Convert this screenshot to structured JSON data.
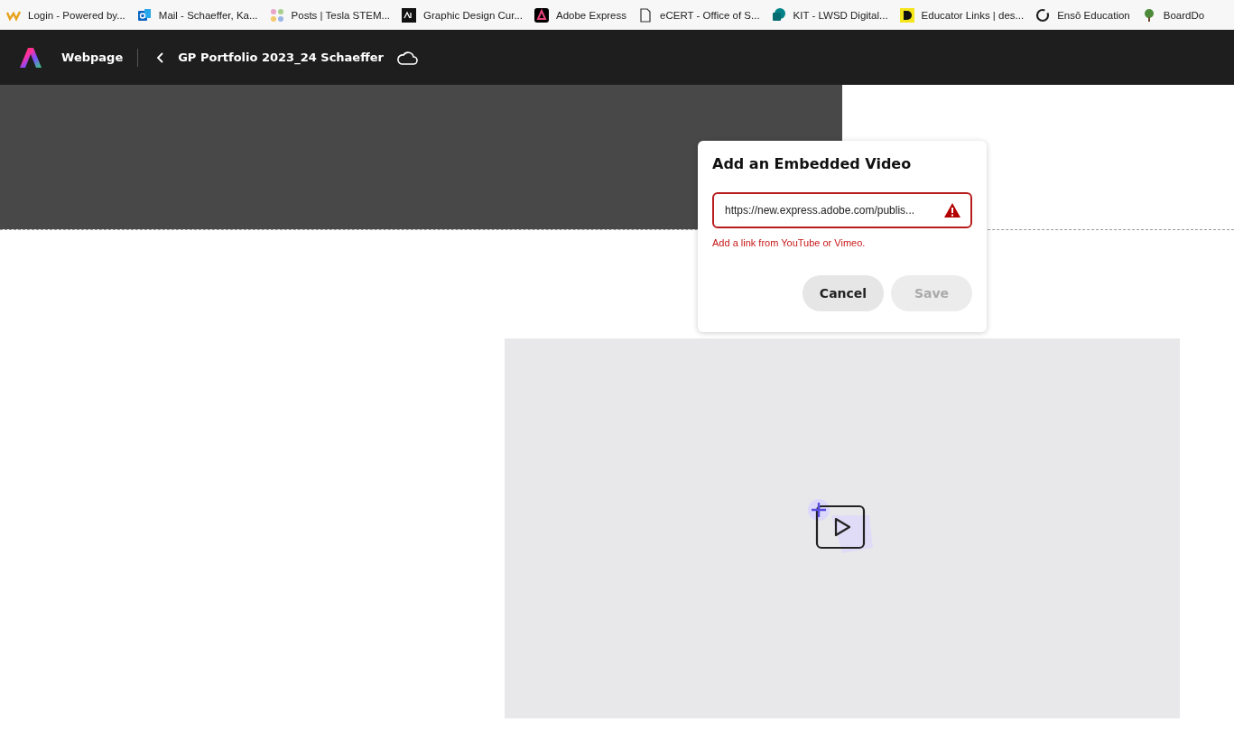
{
  "bookmarks": [
    {
      "label": "Login - Powered by..."
    },
    {
      "label": "Mail - Schaeffer, Ka..."
    },
    {
      "label": "Posts | Tesla STEM..."
    },
    {
      "label": "Graphic Design Cur..."
    },
    {
      "label": "Adobe Express"
    },
    {
      "label": "eCERT - Office of S..."
    },
    {
      "label": "KIT - LWSD Digital..."
    },
    {
      "label": "Educator Links | des..."
    },
    {
      "label": "Ensō Education"
    },
    {
      "label": "BoardDo"
    }
  ],
  "app_bar": {
    "mode": "Webpage",
    "project_title": "GP Portfolio 2023_24 Schaeffer"
  },
  "dialog": {
    "title": "Add an Embedded Video",
    "field": {
      "value": "https://new.express.adobe.com/publis...",
      "error": true
    },
    "error_message": "Add a link from YouTube or Vimeo.",
    "buttons": [
      {
        "label": "Cancel",
        "disabled": false
      },
      {
        "label": "Save",
        "disabled": true
      }
    ]
  }
}
